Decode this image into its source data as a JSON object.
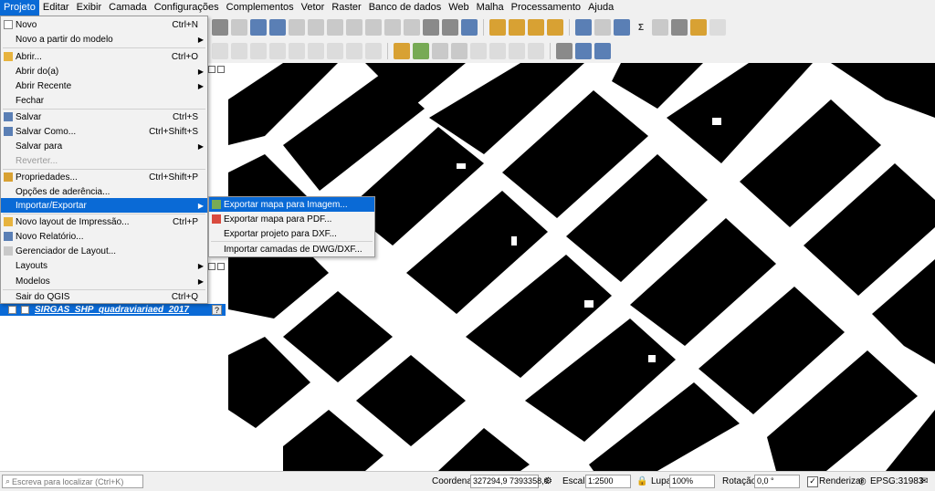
{
  "menubar": {
    "items": [
      "Projeto",
      "Editar",
      "Exibir",
      "Camada",
      "Configurações",
      "Complementos",
      "Vetor",
      "Raster",
      "Banco de dados",
      "Web",
      "Malha",
      "Processamento",
      "Ajuda"
    ],
    "active": "Projeto"
  },
  "menu": {
    "items": [
      {
        "label": "Novo",
        "shortcut": "Ctrl+N"
      },
      {
        "label": "Novo a partir do modelo",
        "submenu": true
      },
      {
        "label": "Abrir...",
        "shortcut": "Ctrl+O"
      },
      {
        "label": "Abrir do(a)",
        "submenu": true
      },
      {
        "label": "Abrir Recente",
        "submenu": true
      },
      {
        "label": "Fechar"
      },
      {
        "label": "Salvar",
        "shortcut": "Ctrl+S"
      },
      {
        "label": "Salvar Como...",
        "shortcut": "Ctrl+Shift+S"
      },
      {
        "label": "Salvar para",
        "submenu": true
      },
      {
        "label": "Reverter...",
        "disabled": true
      },
      {
        "label": "Propriedades...",
        "shortcut": "Ctrl+Shift+P"
      },
      {
        "label": "Opções de aderência..."
      },
      {
        "label": "Importar/Exportar",
        "submenu": true,
        "highlighted": true
      },
      {
        "label": "Novo layout de Impressão...",
        "shortcut": "Ctrl+P"
      },
      {
        "label": "Novo Relatório..."
      },
      {
        "label": "Gerenciador de Layout..."
      },
      {
        "label": "Layouts",
        "submenu": true
      },
      {
        "label": "Modelos",
        "submenu": true
      },
      {
        "label": "Sair do QGIS",
        "shortcut": "Ctrl+Q"
      }
    ]
  },
  "submenu": {
    "items": [
      {
        "label": "Exportar mapa para Imagem...",
        "highlighted": true
      },
      {
        "label": "Exportar mapa para PDF..."
      },
      {
        "label": "Exportar projeto para DXF..."
      },
      {
        "label": "Importar camadas de DWG/DXF..."
      }
    ]
  },
  "layers": {
    "items": [
      {
        "name": "SIRGAS_SHP_quadraviariaed_2017",
        "selected": true
      }
    ]
  },
  "statusbar": {
    "locator_placeholder": "Escreva para localizar (Ctrl+K)",
    "coord_label": "Coordenada",
    "coord_value": "327294,9  7393358,0",
    "scale_label": "Escala",
    "scale_value": "1:2500",
    "zoom_label": "Lupa",
    "zoom_value": "100%",
    "rotation_label": "Rotação",
    "rotation_value": "0,0 °",
    "render_label": "Renderizar",
    "crs": "EPSG:31983"
  },
  "colors": {
    "accent": "#0a6ad6",
    "map_background": "#ffffff",
    "map_features": "#000000"
  }
}
